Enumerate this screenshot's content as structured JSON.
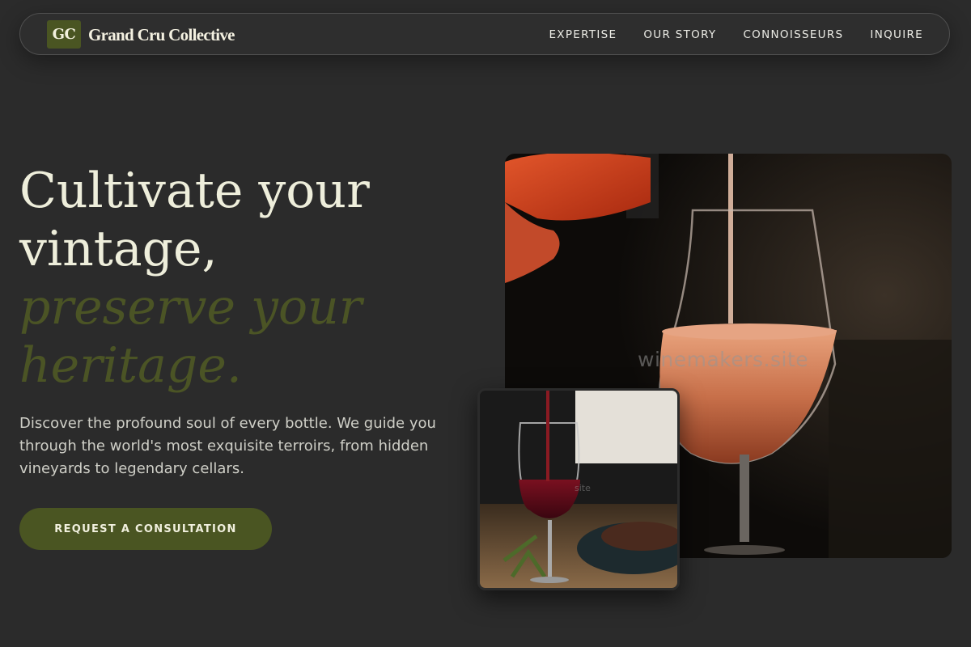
{
  "brand": {
    "mark": "GC",
    "name": "Grand Cru Collective"
  },
  "nav": {
    "links": [
      {
        "label": "EXPERTISE"
      },
      {
        "label": "OUR STORY"
      },
      {
        "label": "CONNOISSEURS"
      },
      {
        "label": "INQUIRE"
      }
    ]
  },
  "hero": {
    "headline_lines": [
      "Cultivate your",
      "vintage,"
    ],
    "headline_accent_lines": [
      "preserve your",
      "heritage."
    ],
    "subtext": "Discover the profound soul of every bottle. We guide you through the world's most exquisite terroirs, from hidden vineyards to legendary cellars.",
    "cta_label": "REQUEST A CONSULTATION"
  },
  "images": {
    "watermark": "winemakers.site",
    "small_watermark": "site"
  },
  "colors": {
    "background": "#2b2b2b",
    "accent_olive": "#4a5522",
    "headline_cream": "#eeeedb",
    "headline_accent": "#4b5425"
  },
  "icons": [
    "logo-mark"
  ]
}
